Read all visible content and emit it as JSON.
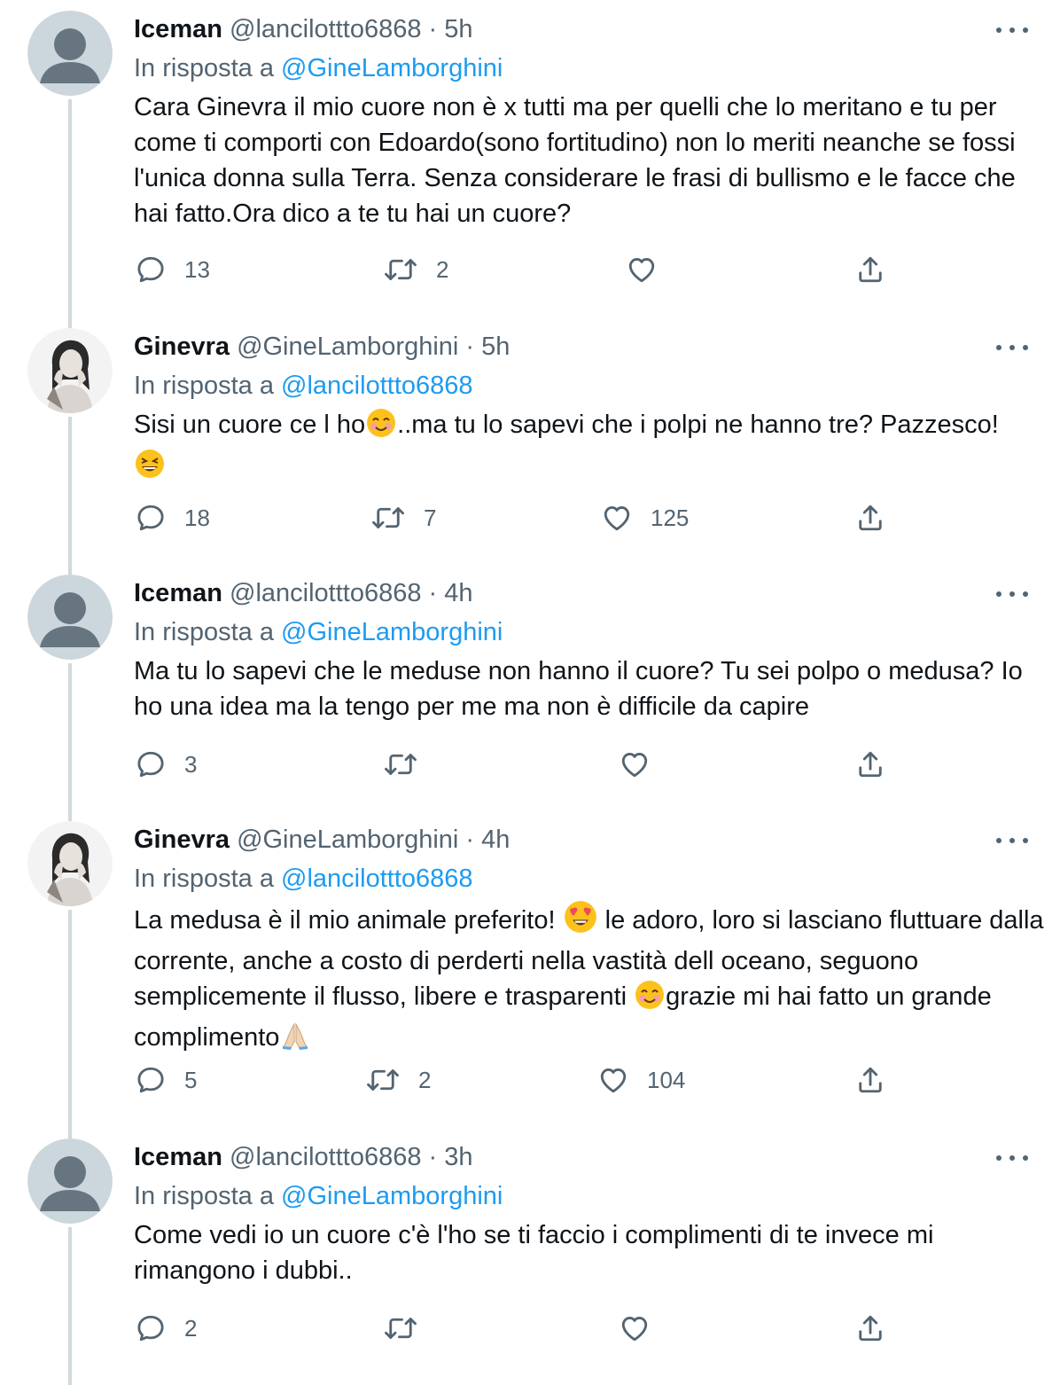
{
  "tweets": [
    {
      "name": "Iceman",
      "handle": "@lancilottto6868",
      "dot": "·",
      "time": "5h",
      "reply_prefix": "In risposta a",
      "reply_to": "@GineLamborghini",
      "avatar": "default-avatar",
      "text_parts": [
        "Cara Ginevra il mio cuore non è x tutti ma per quelli che lo meritano e tu per come ti comporti con Edoardo(sono fortitudino) non lo meriti neanche se fossi l'unica donna sulla Terra. Senza considerare le frasi di bullismo e le facce che hai fatto.Ora dico a te tu hai un cuore?"
      ],
      "replies": "13",
      "retweets": "2",
      "likes": ""
    },
    {
      "name": "Ginevra",
      "handle": "@GineLamborghini",
      "dot": "·",
      "time": "5h",
      "reply_prefix": "In risposta a",
      "reply_to": "@lancilottto6868",
      "avatar": "profile-photo",
      "text_parts": [
        "Sisi un cuore ce l ho",
        "..ma tu lo sapevi che i polpi ne hanno tre? Pazzesco!"
      ],
      "emojis": [
        "smiling-face-with-smiling-eyes",
        "grinning-squinting-face"
      ],
      "replies": "18",
      "retweets": "7",
      "likes": "125"
    },
    {
      "name": "Iceman",
      "handle": "@lancilottto6868",
      "dot": "·",
      "time": "4h",
      "reply_prefix": "In risposta a",
      "reply_to": "@GineLamborghini",
      "avatar": "default-avatar",
      "text_parts": [
        "Ma tu lo sapevi che le meduse non hanno il cuore? Tu sei polpo o medusa? Io ho una idea ma la tengo per me ma non è difficile da capire"
      ],
      "replies": "3",
      "retweets": "",
      "likes": ""
    },
    {
      "name": "Ginevra",
      "handle": "@GineLamborghini",
      "dot": "·",
      "time": "4h",
      "reply_prefix": "In risposta a",
      "reply_to": "@lancilottto6868",
      "avatar": "profile-photo",
      "text_parts": [
        "La medusa è il mio animale preferito! ",
        " le adoro, loro si lasciano fluttuare dalla corrente, anche a costo di perderti nella vastità dell oceano, seguono semplicemente il flusso, libere e trasparenti ",
        "grazie mi hai fatto un grande complimento"
      ],
      "emojis": [
        "smiling-face-with-heart-eyes",
        "smiling-face-with-smiling-eyes",
        "folded-hands"
      ],
      "replies": "5",
      "retweets": "2",
      "likes": "104"
    },
    {
      "name": "Iceman",
      "handle": "@lancilottto6868",
      "dot": "·",
      "time": "3h",
      "reply_prefix": "In risposta a",
      "reply_to": "@GineLamborghini",
      "avatar": "default-avatar",
      "text_parts": [
        "Come vedi io un cuore c'è l'ho se ti faccio i complimenti di te invece mi rimangono i dubbi.."
      ],
      "replies": "2",
      "retweets": "",
      "likes": ""
    }
  ],
  "icons": {
    "reply": "reply-icon",
    "retweet": "retweet-icon",
    "like": "like-icon",
    "share": "share-icon",
    "more": "more-icon"
  },
  "colors": {
    "text": "#0f1419",
    "secondary": "#536471",
    "link": "#1d9bf0",
    "thread_line": "#cfd9de",
    "default_avatar_bg": "#ccd6dd",
    "default_avatar_fg": "#66757f"
  }
}
